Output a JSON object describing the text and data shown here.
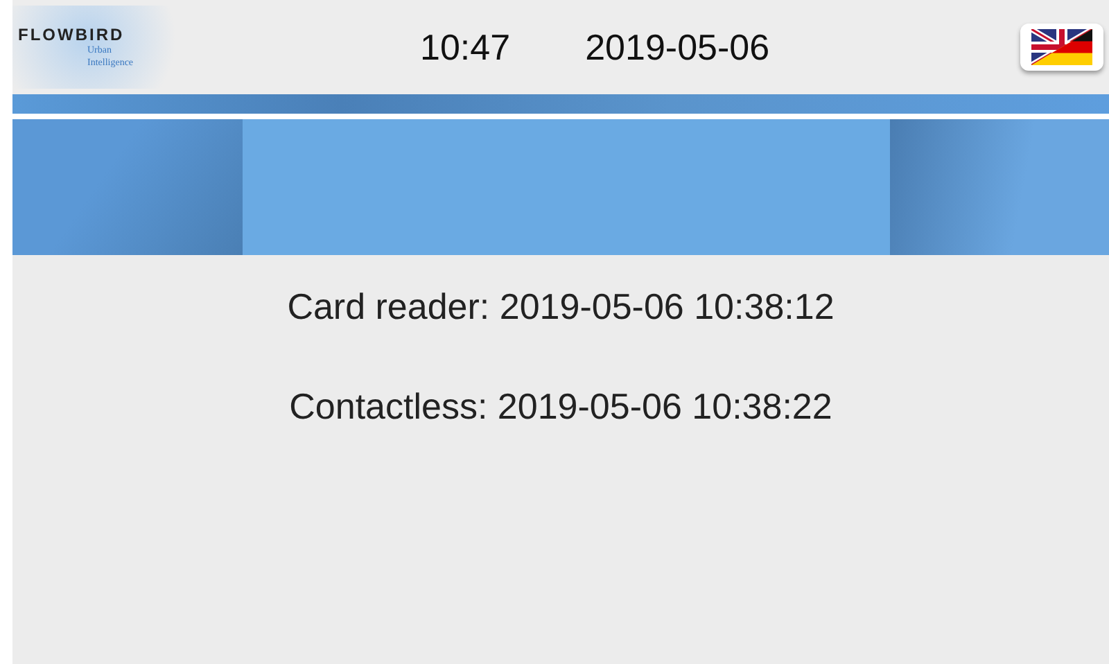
{
  "header": {
    "logo": {
      "name": "FLOWBIRD",
      "tagline_1": "Urban",
      "tagline_2": "Intelligence"
    },
    "time": "10:47",
    "date": "2019-05-06"
  },
  "lines": [
    "Card reader: 2019-05-06 10:38:12",
    "Contactless: 2019-05-06 10:38:22"
  ]
}
